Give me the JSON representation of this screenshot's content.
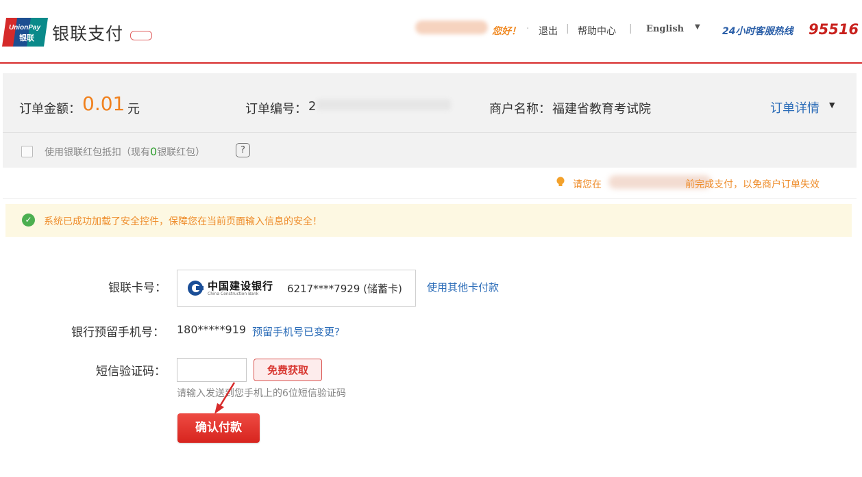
{
  "header": {
    "logo_line1": "UnionPay",
    "logo_line2": "银联",
    "brand_title": "银联支付",
    "greeting": "您好！",
    "logout": "退出",
    "help": "帮助中心",
    "language": "English",
    "hotline_label": "24小时客服热线",
    "hotline_number": "95516"
  },
  "order": {
    "amount_label": "订单金额：",
    "amount": "0.01",
    "amount_unit": "元",
    "number_label": "订单编号：",
    "number_prefix": "2",
    "merchant_label": "商户名称：",
    "merchant": "福建省教育考试院",
    "details_link": "订单详情"
  },
  "red_packet": {
    "text_before": "使用银联红包抵扣（现有",
    "count": "0",
    "text_after": "银联红包）"
  },
  "tip": {
    "text_before": "请您在",
    "text_after": "前完成支付，以免商户订单失效"
  },
  "notice": {
    "text": "系统已成功加载了安全控件，保障您在当前页面输入信息的安全！"
  },
  "form": {
    "card_label": "银联卡号：",
    "bank_name": "中国建设银行",
    "bank_name_en": "China Construction Bank",
    "card_number": "6217****7929 (储蓄卡)",
    "other_card_link": "使用其他卡付款",
    "phone_label": "银行预留手机号：",
    "phone_value": "180*****919",
    "phone_changed_link": "预留手机号已变更?",
    "sms_label": "短信验证码：",
    "sms_value": "",
    "sms_button": "免费获取",
    "sms_hint": "请输入发送到您手机上的6位短信验证码",
    "confirm_button": "确认付款"
  },
  "colors": {
    "accent_red": "#d72a2a",
    "amount_orange": "#f0811e",
    "link_blue": "#2b6cb8"
  }
}
